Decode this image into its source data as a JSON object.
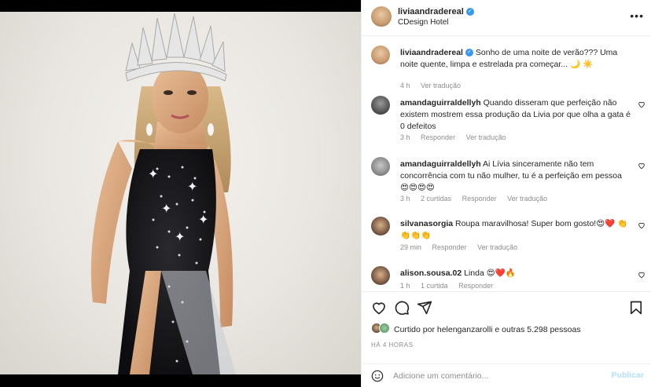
{
  "header": {
    "username": "liviaandradereal",
    "location": "CDesign Hotel"
  },
  "caption": {
    "username": "liviaandradereal",
    "text": "Sonho de uma noite de verão??? Uma noite quente, limpa e estrelada pra começar... 🌙 ☀️",
    "time": "4 h",
    "translate": "Ver tradução"
  },
  "comments": [
    {
      "username": "amandaguirraldellyh",
      "text": "Quando disseram que perfeição não existem mostrem essa produção da Livia por que olha a gata é 0 defeitos",
      "time": "3 h",
      "likes": "",
      "reply": "Responder",
      "translate": "Ver tradução"
    },
    {
      "username": "amandaguirraldellyh",
      "text": "Ai Lívia sinceramente não tem concorrência com tu não mulher, tu é a perfeição em pessoa 😍😍😍😍",
      "time": "3 h",
      "likes": "2 curtidas",
      "reply": "Responder",
      "translate": "Ver tradução"
    },
    {
      "username": "silvanasorgia",
      "text": "Roupa maravilhosa! Super bom gosto!😍❤️ 👏👏👏👏",
      "time": "29 min",
      "likes": "",
      "reply": "Responder",
      "translate": "Ver tradução"
    },
    {
      "username": "alison.sousa.02",
      "text": "Linda 😍❤️🔥",
      "time": "1 h",
      "likes": "1 curtida",
      "reply": "Responder",
      "translate": ""
    }
  ],
  "likes": {
    "text": "Curtido por helenganzarolli e outras 5.298 pessoas"
  },
  "time_ago": "HÁ 4 HORAS",
  "composer": {
    "placeholder": "Adicione um comentário...",
    "post_label": "Publicar"
  },
  "colors": {
    "accent": "#3897f0",
    "post_disabled": "#b2dffc",
    "secondary_text": "#8e8e8e"
  }
}
